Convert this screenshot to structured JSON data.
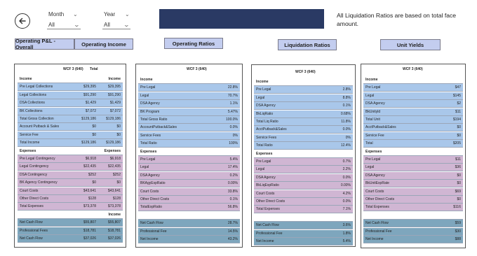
{
  "filters": {
    "month": {
      "label": "Month",
      "value": "All"
    },
    "year": {
      "label": "Year",
      "value": "All"
    }
  },
  "note": "All Liquidation Ratios are based on total face amount.",
  "nav": [
    "Operating P&L - Overall",
    "Operating Income",
    "Operating Ratios",
    "Liquidation Ratios",
    "Unit Yields"
  ],
  "panel1": {
    "title": "WCF 3 (640)",
    "title2": "Total",
    "income_header": [
      "Income",
      "Income"
    ],
    "income": [
      [
        "Pre Legal Collections",
        "$29,395",
        "$29,395"
      ],
      [
        "Legal Collections",
        "$91,290",
        "$91,290"
      ],
      [
        "DSA Collections",
        "$1,429",
        "$1,429"
      ],
      [
        "BK Collections",
        "$7,072",
        "$7,072"
      ],
      [
        "Total Gross Collection",
        "$129,186",
        "$129,186"
      ],
      [
        "Account Putback & Sales",
        "$0",
        "$0"
      ],
      [
        "Service Fee",
        "$0",
        "$0"
      ],
      [
        "Total Income",
        "$129,186",
        "$129,186"
      ]
    ],
    "expense_header": [
      "Expenses",
      "Expenses"
    ],
    "expenses": [
      [
        "Pre Legal Contingency",
        "$6,918",
        "$6,918"
      ],
      [
        "Legal Contingency",
        "$22,435",
        "$22,435"
      ],
      [
        "DSA Contingency",
        "$252",
        "$252"
      ],
      [
        "BK Agency Contingency",
        "$0",
        "$0"
      ],
      [
        "Court Costs",
        "$43,641",
        "$43,641"
      ],
      [
        "Other Direct Costs",
        "$128",
        "$128"
      ],
      [
        "Total Expenses",
        "$73,378",
        "$73,378"
      ]
    ],
    "net_header": [
      "",
      "Income"
    ],
    "net": [
      [
        "Net Cash Flow",
        "$55,807",
        "$55,807"
      ],
      [
        "Professional Fees",
        "$18,781",
        "$18,781"
      ],
      [
        "Net Cash Flow",
        "$37,026",
        "$37,026"
      ]
    ]
  },
  "panel2": {
    "title": "WCF 3 (640)",
    "income_header": "Income",
    "income": [
      [
        "Pre Legal",
        "22.8%"
      ],
      [
        "Legal",
        "70.7%"
      ],
      [
        "DSA Agency",
        "1.1%"
      ],
      [
        "BK Program",
        "5.47%"
      ],
      [
        "Total Gross Ratio",
        "100.0%"
      ],
      [
        "AccountPutback&Sales",
        "0.0%"
      ],
      [
        "Service Fees",
        "0%"
      ],
      [
        "Total Ratio",
        "100%"
      ]
    ],
    "expense_header": "Expenses",
    "expenses": [
      [
        "Pre Legal",
        "5.4%"
      ],
      [
        "Legal",
        "17.4%"
      ],
      [
        "DSA Agency",
        "0.2%"
      ],
      [
        "BKAgyExpRatio",
        "0.00%"
      ],
      [
        "Court Costs",
        "33.8%"
      ],
      [
        "Other Direct Costs",
        "0.1%"
      ],
      [
        "TotalExpRatio",
        "56.8%"
      ]
    ],
    "net": [
      [
        "Net Cash Flow",
        "28.7%"
      ],
      [
        "Professional Fee",
        "14.5%"
      ],
      [
        "Net Income",
        "43.2%"
      ]
    ]
  },
  "panel3": {
    "title": "WCF 3 (640)",
    "income_header": "Income",
    "income": [
      [
        "Pre Legal",
        "2.8%"
      ],
      [
        "Legal",
        "8.8%"
      ],
      [
        "DSA Agency",
        "0.1%"
      ],
      [
        "BkLiqRatio",
        "0.68%"
      ],
      [
        "Total Liq Ratio",
        "11.8%"
      ],
      [
        "AcctPutback&Sales",
        "0.0%"
      ],
      [
        "Service Fees",
        "0%"
      ],
      [
        "Total Ratio",
        "12.4%"
      ]
    ],
    "expense_header": "Expenses",
    "expenses": [
      [
        "Pre Legal",
        "0.7%"
      ],
      [
        "Legal",
        "2.2%"
      ],
      [
        "DSA Agency",
        "0.0%"
      ],
      [
        "BkLiqExpRatio",
        "0.00%"
      ],
      [
        "Court Costs",
        "4.2%"
      ],
      [
        "Other Direct Costs",
        "0.0%"
      ],
      [
        "Total Expenses",
        "7.1%"
      ]
    ],
    "net": [
      [
        "Net Cash Flow",
        "3.6%"
      ],
      [
        "Professional Fee",
        "1.8%"
      ],
      [
        "Net Income",
        "5.4%"
      ]
    ]
  },
  "panel4": {
    "title": "WCF 3 (640)",
    "income_header": "Income",
    "income": [
      [
        "Pre Legal",
        "$47"
      ],
      [
        "Legal",
        "$145"
      ],
      [
        "DSA Agency",
        "$2"
      ],
      [
        "BkUnityld",
        "$11"
      ],
      [
        "Total Unit",
        "$194"
      ],
      [
        "AcctPutback&Sales",
        "$0"
      ],
      [
        "Service Fee",
        "$0"
      ],
      [
        "Total",
        "$205"
      ]
    ],
    "expense_header": "Expenses",
    "expenses": [
      [
        "Pre Legal",
        "$11"
      ],
      [
        "Legal",
        "$36"
      ],
      [
        "DSA Agency",
        "$0"
      ],
      [
        "BkUnitExpRate",
        "$0"
      ],
      [
        "Court Costs",
        "$69"
      ],
      [
        "Other Direct Costs",
        "$0"
      ],
      [
        "Total Expenses",
        "$116"
      ]
    ],
    "net": [
      [
        "Net Cash Flow",
        "$59"
      ],
      [
        "Professional Fee",
        "$30"
      ],
      [
        "Net Income",
        "$88"
      ]
    ]
  }
}
